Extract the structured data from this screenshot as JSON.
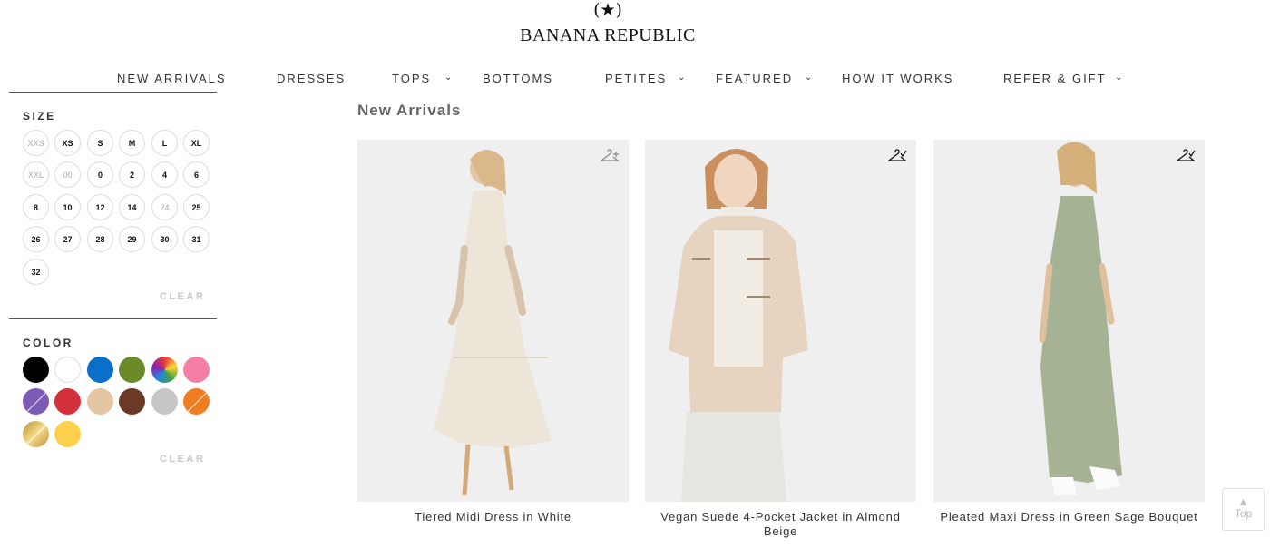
{
  "brand": {
    "mark": "(★)",
    "name": "BANANA REPUBLIC"
  },
  "nav": {
    "items": [
      {
        "label": "NEW ARRIVALS",
        "has_dropdown": false
      },
      {
        "label": "DRESSES",
        "has_dropdown": false
      },
      {
        "label": "TOPS",
        "has_dropdown": true
      },
      {
        "label": "BOTTOMS",
        "has_dropdown": false
      },
      {
        "label": "PETITES",
        "has_dropdown": true
      },
      {
        "label": "FEATURED",
        "has_dropdown": true
      },
      {
        "label": "HOW IT WORKS",
        "has_dropdown": false
      },
      {
        "label": "REFER & GIFT",
        "has_dropdown": true
      }
    ],
    "active": "NEW ARRIVALS",
    "chevron": "⌄"
  },
  "filters": {
    "size": {
      "title": "SIZE",
      "options": [
        {
          "label": "XXS",
          "available": false
        },
        {
          "label": "XS",
          "available": true
        },
        {
          "label": "S",
          "available": true
        },
        {
          "label": "M",
          "available": true
        },
        {
          "label": "L",
          "available": true
        },
        {
          "label": "XL",
          "available": true
        },
        {
          "label": "XXL",
          "available": false
        },
        {
          "label": "00",
          "available": false
        },
        {
          "label": "0",
          "available": true
        },
        {
          "label": "2",
          "available": true
        },
        {
          "label": "4",
          "available": true
        },
        {
          "label": "6",
          "available": true
        },
        {
          "label": "8",
          "available": true
        },
        {
          "label": "10",
          "available": true
        },
        {
          "label": "12",
          "available": true
        },
        {
          "label": "14",
          "available": true
        },
        {
          "label": "24",
          "available": false
        },
        {
          "label": "25",
          "available": true
        },
        {
          "label": "26",
          "available": true
        },
        {
          "label": "27",
          "available": true
        },
        {
          "label": "28",
          "available": true
        },
        {
          "label": "29",
          "available": true
        },
        {
          "label": "30",
          "available": true
        },
        {
          "label": "31",
          "available": true
        },
        {
          "label": "32",
          "available": true
        }
      ],
      "clear_label": "CLEAR"
    },
    "color": {
      "title": "COLOR",
      "swatches": [
        {
          "name": "black",
          "color": "#000000"
        },
        {
          "name": "white",
          "color": "#ffffff"
        },
        {
          "name": "blue",
          "color": "#0a6fc9"
        },
        {
          "name": "green",
          "color": "#6b8a2a"
        },
        {
          "name": "multi",
          "color": "rainbow"
        },
        {
          "name": "pink",
          "color": "#f57ea4"
        },
        {
          "name": "purple",
          "color": "#7b5bb5",
          "slashed": true
        },
        {
          "name": "red",
          "color": "#d3303c"
        },
        {
          "name": "beige",
          "color": "#e3c6a4"
        },
        {
          "name": "brown",
          "color": "#6a3a26"
        },
        {
          "name": "gray",
          "color": "#c6c6c6"
        },
        {
          "name": "orange",
          "color": "#f07d22",
          "slashed": true
        },
        {
          "name": "gold",
          "color": "gold-gradient",
          "slashed": true
        },
        {
          "name": "yellow",
          "color": "#fdd14e"
        }
      ],
      "clear_label": "CLEAR"
    }
  },
  "page_heading": "New Arrivals",
  "products": [
    {
      "name": "Tiered Midi Dress in White",
      "hanger_icon": "hanger-add-icon",
      "garment_color": "#ede7dc",
      "bg": "#efefef"
    },
    {
      "name": "Vegan Suede 4-Pocket Jacket in Almond Beige",
      "hanger_icon": "hanger-check-icon",
      "garment_color": "#e6d3c0",
      "bg": "#efefef"
    },
    {
      "name": "Pleated Maxi Dress in Green Sage Bouquet",
      "hanger_icon": "hanger-check-icon",
      "garment_color": "#a5b394",
      "bg": "#efefef"
    }
  ],
  "scroll_top": {
    "arrow": "▲",
    "label": "Top"
  }
}
